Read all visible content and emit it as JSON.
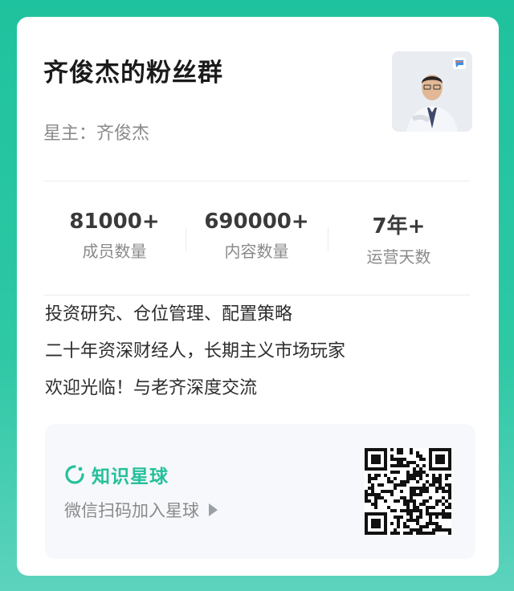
{
  "group": {
    "title": "齐俊杰的粉丝群",
    "owner_line": "星主：齐俊杰"
  },
  "stats": [
    {
      "value": "81000+",
      "label": "成员数量"
    },
    {
      "value": "690000+",
      "label": "内容数量"
    },
    {
      "value": "7年+",
      "label": "运营天数"
    }
  ],
  "description": [
    "投资研究、仓位管理、配置策略",
    "二十年资深财经人，长期主义市场玩家",
    "欢迎光临！与老齐深度交流"
  ],
  "promo": {
    "brand": "知识星球",
    "cta": "微信扫码加入星球"
  },
  "colors": {
    "brand_green": "#25c09b",
    "background_green": "#1fc29e"
  }
}
